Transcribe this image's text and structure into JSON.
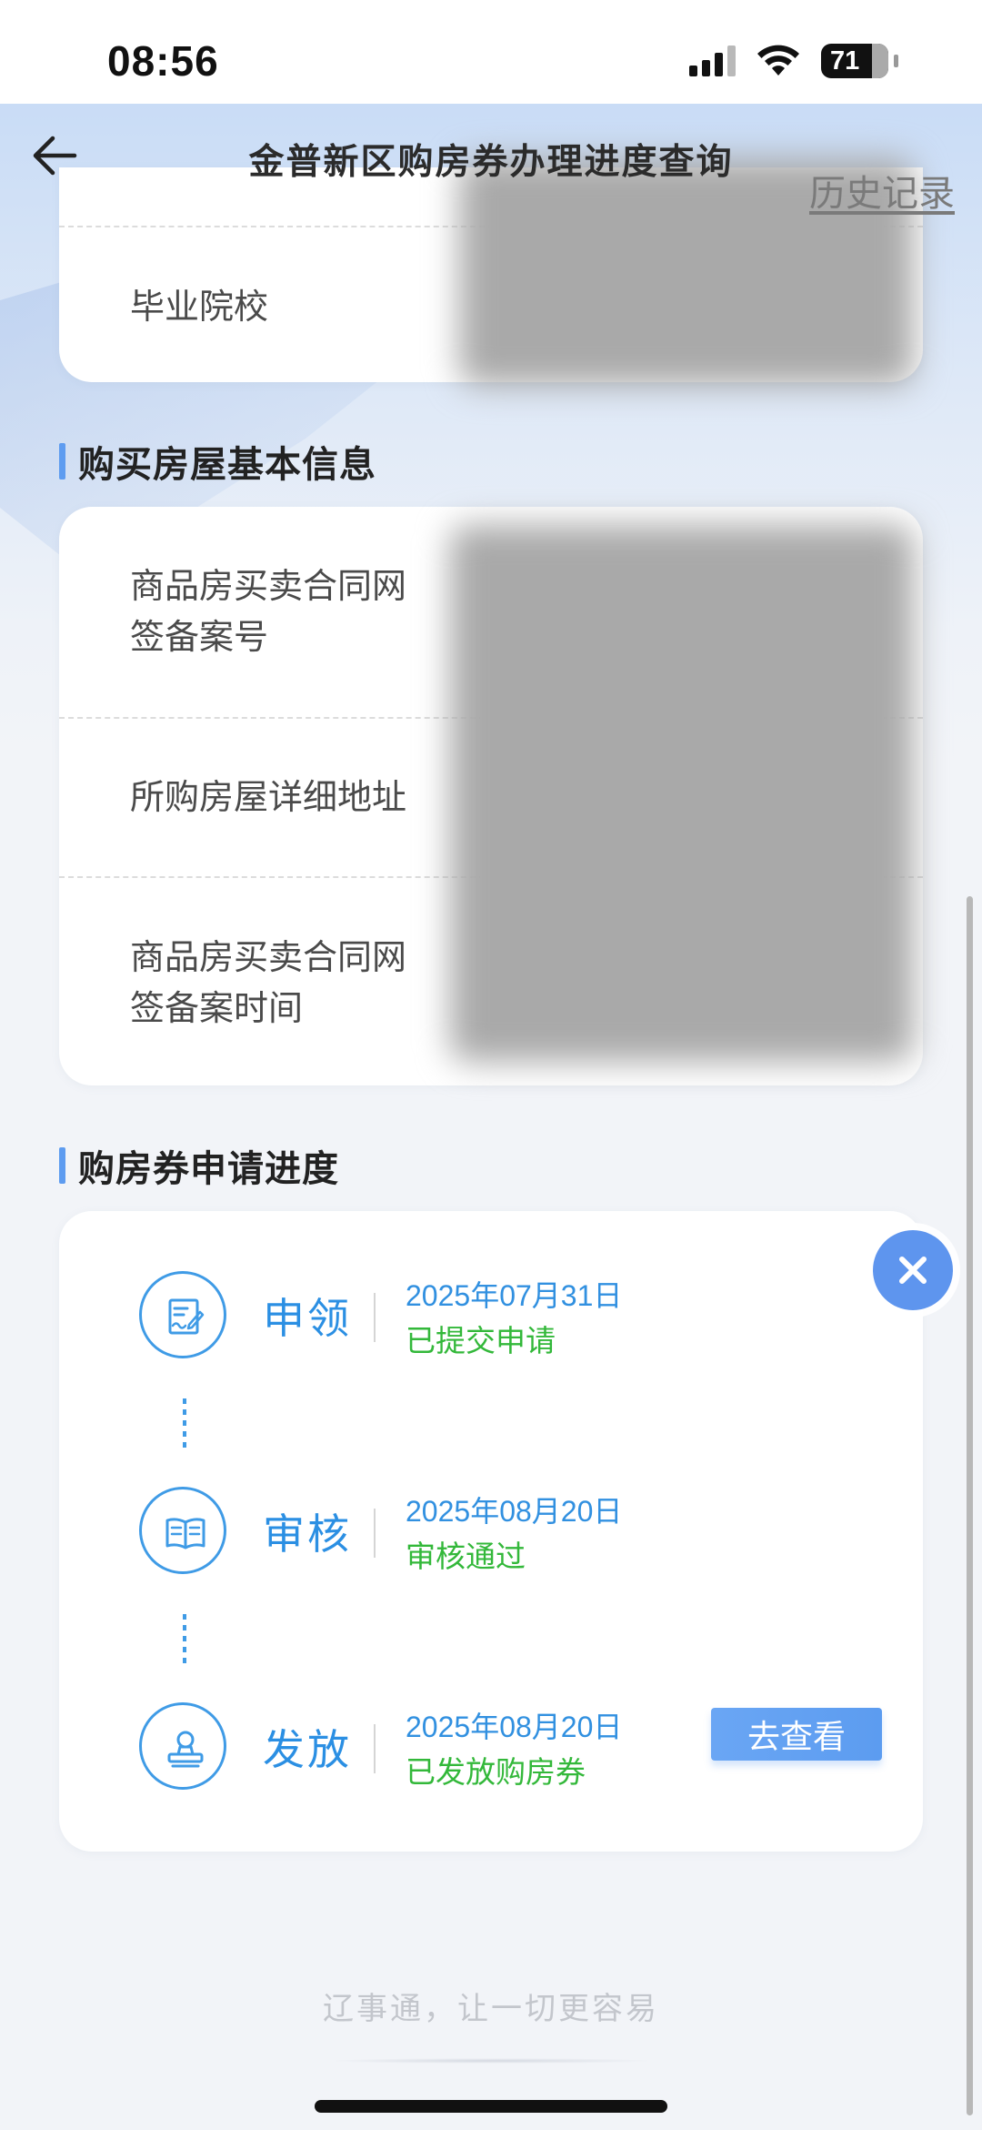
{
  "status_bar": {
    "time": "08:56",
    "battery": "71"
  },
  "nav": {
    "title": "金普新区购房券办理进度查询",
    "history": "历史记录"
  },
  "education_card": {
    "school_label": "毕业院校"
  },
  "house_section": {
    "title": "购买房屋基本信息",
    "rows": [
      {
        "label_line1": "商品房买卖合同网",
        "label_line2": "签备案号"
      },
      {
        "label_line1": "所购房屋详细地址"
      },
      {
        "label_line1": "商品房买卖合同网",
        "label_line2": "签备案时间"
      }
    ]
  },
  "progress_section": {
    "title": "购房券申请进度",
    "steps": [
      {
        "name": "申领",
        "date": "2025年07月31日",
        "status": "已提交申请",
        "icon": "application-form-icon"
      },
      {
        "name": "审核",
        "date": "2025年08月20日",
        "status": "审核通过",
        "icon": "open-book-icon"
      },
      {
        "name": "发放",
        "date": "2025年08月20日",
        "status": "已发放购房券",
        "icon": "stamp-icon"
      }
    ],
    "view_button": "去查看"
  },
  "footer": {
    "slogan": "辽事通，让一切更容易"
  },
  "colors": {
    "accent": "#3f9be6",
    "status_green": "#33b83a",
    "button_blue": "#5e9cf0"
  }
}
